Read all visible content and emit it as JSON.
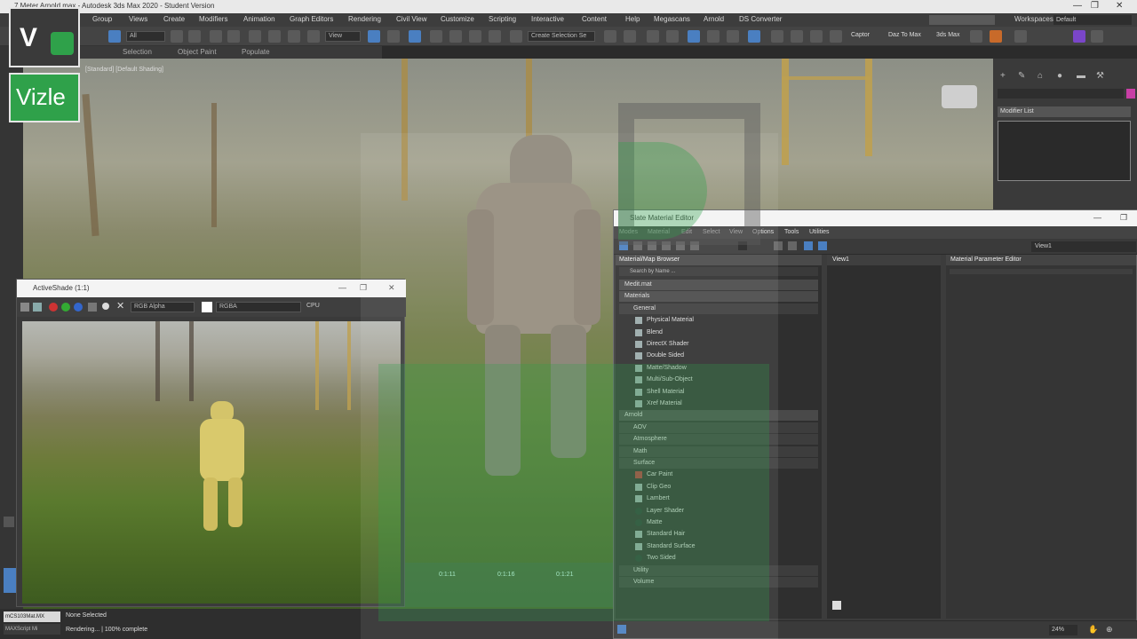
{
  "window": {
    "title": "7 Meter Arnold.max - Autodesk 3ds Max 2020 - Student Version",
    "min": "—",
    "max": "❐",
    "close": "✕"
  },
  "menu": {
    "items": [
      "Group",
      "Views",
      "Create",
      "Modifiers",
      "Animation",
      "Graph Editors",
      "Rendering",
      "Civil View",
      "Customize",
      "Scripting",
      "Interactive",
      "Content",
      "Help",
      "Megascans",
      "Arnold",
      "DS Converter"
    ],
    "workspaces_label": "Workspaces:",
    "workspaces_value": "Default"
  },
  "toolbar": {
    "filter_value": "All",
    "view_value": "View",
    "selection_set": "Create Selection Se",
    "captor": "Captor",
    "daz": "Daz To Max",
    "ibmax": "3ds Max"
  },
  "ribbon": {
    "tabs": [
      "Selection",
      "Object Paint",
      "Populate"
    ]
  },
  "viewport": {
    "label": "[Standard] [Default Shading]"
  },
  "command_panel": {
    "modifier_list": "Modifier List"
  },
  "activeshade": {
    "title": "ActiveShade (1:1)",
    "channel": "RGB Alpha",
    "display": "RGBA",
    "device": "CPU"
  },
  "slate": {
    "title": "Slate Material Editor",
    "menus": [
      "Modes",
      "Material",
      "Edit",
      "Select",
      "View",
      "Options",
      "Tools",
      "Utilities"
    ],
    "view_tab": "View1",
    "browser_header": "Material/Map Browser",
    "search_placeholder": "Search by Name ...",
    "view_header": "View1",
    "params_header": "Material Parameter Editor",
    "rows": [
      {
        "label": "Medit.mat",
        "type": "cat",
        "swatch": "none"
      },
      {
        "label": "Materials",
        "type": "cat",
        "swatch": "none"
      },
      {
        "label": "General",
        "type": "sub",
        "swatch": "none"
      },
      {
        "label": "Physical Material",
        "type": "item",
        "swatch": "grey"
      },
      {
        "label": "Blend",
        "type": "item",
        "swatch": "grey"
      },
      {
        "label": "DirectX Shader",
        "type": "item",
        "swatch": "grey"
      },
      {
        "label": "Double Sided",
        "type": "item",
        "swatch": "grey"
      },
      {
        "label": "Matte/Shadow",
        "type": "item",
        "swatch": "grey"
      },
      {
        "label": "Multi/Sub-Object",
        "type": "item",
        "swatch": "grey"
      },
      {
        "label": "Shell Material",
        "type": "item",
        "swatch": "grey"
      },
      {
        "label": "Xref Material",
        "type": "item",
        "swatch": "grey"
      },
      {
        "label": "Arnold",
        "type": "cat",
        "swatch": "none"
      },
      {
        "label": "AOV",
        "type": "sub",
        "swatch": "none"
      },
      {
        "label": "Atmosphere",
        "type": "sub",
        "swatch": "none"
      },
      {
        "label": "Math",
        "type": "sub",
        "swatch": "none"
      },
      {
        "label": "Surface",
        "type": "sub",
        "swatch": "none"
      },
      {
        "label": "Car Paint",
        "type": "item",
        "swatch": "red"
      },
      {
        "label": "Clip Geo",
        "type": "item",
        "swatch": "grey"
      },
      {
        "label": "Lambert",
        "type": "item",
        "swatch": "grey"
      },
      {
        "label": "Layer Shader",
        "type": "item",
        "swatch": "dark"
      },
      {
        "label": "Matte",
        "type": "item",
        "swatch": "dark"
      },
      {
        "label": "Standard Hair",
        "type": "item",
        "swatch": "grey"
      },
      {
        "label": "Standard Surface",
        "type": "item",
        "swatch": "grey"
      },
      {
        "label": "Two Sided",
        "type": "item",
        "swatch": "dark"
      },
      {
        "label": "Utility",
        "type": "sub",
        "swatch": "none"
      },
      {
        "label": "Volume",
        "type": "sub",
        "swatch": "none"
      }
    ],
    "zoom": "24%"
  },
  "status": {
    "maxscript_top": "mCS103Mat.MX",
    "maxscript_bottom": "MAXScript Mi",
    "selection": "None Selected",
    "rendering": "Rendering... | 100% complete"
  },
  "timeline": {
    "ticks": [
      "0:1:11",
      "0:1:16",
      "0:1:21"
    ]
  },
  "watermark": {
    "letter": "V",
    "brand": "Vizle"
  }
}
